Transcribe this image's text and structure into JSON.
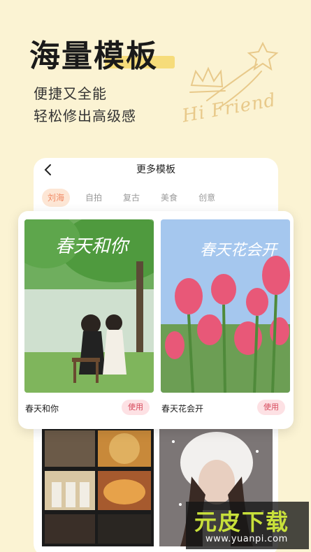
{
  "hero": {
    "title": "海量模板",
    "subtitle_line1": "便捷又全能",
    "subtitle_line2": "轻松修出高级感",
    "doodle_text": "Hi Friend"
  },
  "screen": {
    "title": "更多模板",
    "tabs": [
      {
        "label": "刘海",
        "active": true
      },
      {
        "label": "自拍",
        "active": false
      },
      {
        "label": "复古",
        "active": false
      },
      {
        "label": "美食",
        "active": false
      },
      {
        "label": "创意",
        "active": false
      }
    ]
  },
  "templates": [
    {
      "name": "春天和你",
      "overlay": "春天和你",
      "button": "使用"
    },
    {
      "name": "春天花会开",
      "overlay": "春天花会开",
      "button": "使用"
    }
  ],
  "watermark": {
    "title": "元皮下载",
    "url": "www.yuanpi.com"
  },
  "colors": {
    "background": "#fbf3d3",
    "accent": "#f08a64",
    "button_text": "#d64a5c",
    "watermark": "#c8e03a"
  }
}
